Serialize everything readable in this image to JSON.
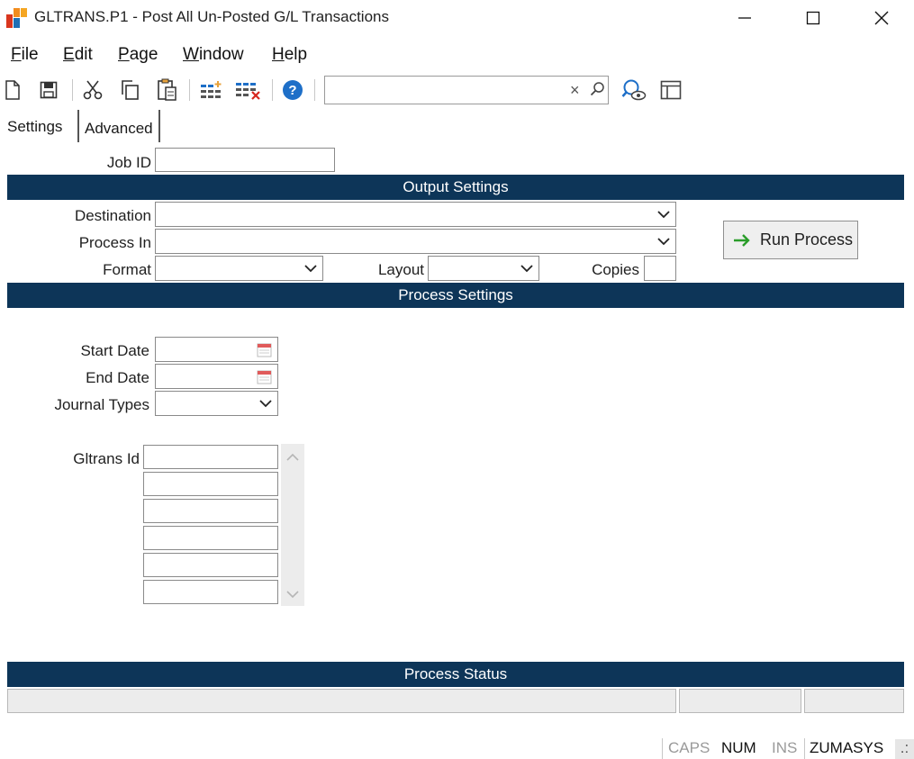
{
  "window": {
    "title": "GLTRANS.P1 - Post All Un-Posted G/L Transactions"
  },
  "menu": {
    "file": {
      "hot": "F",
      "rest": "ile"
    },
    "edit": {
      "hot": "E",
      "rest": "dit"
    },
    "page": {
      "hot": "P",
      "rest": "age"
    },
    "window": {
      "hot": "W",
      "rest": "indow"
    },
    "help": {
      "hot": "H",
      "rest": "elp"
    }
  },
  "toolbar": {
    "icons": [
      "new-icon",
      "save-icon",
      "cut-icon",
      "copy-icon",
      "paste-icon",
      "insert-row-icon",
      "delete-row-icon",
      "help-icon",
      "preview-icon",
      "layout-icon"
    ],
    "search": {
      "value": "",
      "placeholder": "",
      "clear_glyph": "×"
    }
  },
  "tabs": {
    "settings": "Settings",
    "advanced": "Advanced"
  },
  "form": {
    "job_id_label": "Job ID",
    "job_id_value": "",
    "output_settings_title": "Output Settings",
    "destination_label": "Destination",
    "destination_value": "",
    "process_in_label": "Process In",
    "process_in_value": "",
    "format_label": "Format",
    "format_value": "",
    "layout_label": "Layout",
    "layout_value": "",
    "copies_label": "Copies",
    "copies_value": "",
    "run_process_label": "Run Process",
    "process_settings_title": "Process Settings",
    "start_date_label": "Start Date",
    "start_date_value": "",
    "end_date_label": "End Date",
    "end_date_value": "",
    "journal_types_label": "Journal Types",
    "journal_types_value": "",
    "gltrans_id_label": "Gltrans Id",
    "gltrans_ids": [
      "",
      "",
      "",
      "",
      "",
      ""
    ],
    "process_status_title": "Process Status"
  },
  "statusbar": {
    "caps": "CAPS",
    "num": "NUM",
    "ins": "INS",
    "user": "ZUMASYS",
    "grip": ".:"
  },
  "colors": {
    "section_bar": "#0d3558",
    "accent_blue": "#1e6fc8",
    "run_arrow": "#2a9d2a"
  }
}
